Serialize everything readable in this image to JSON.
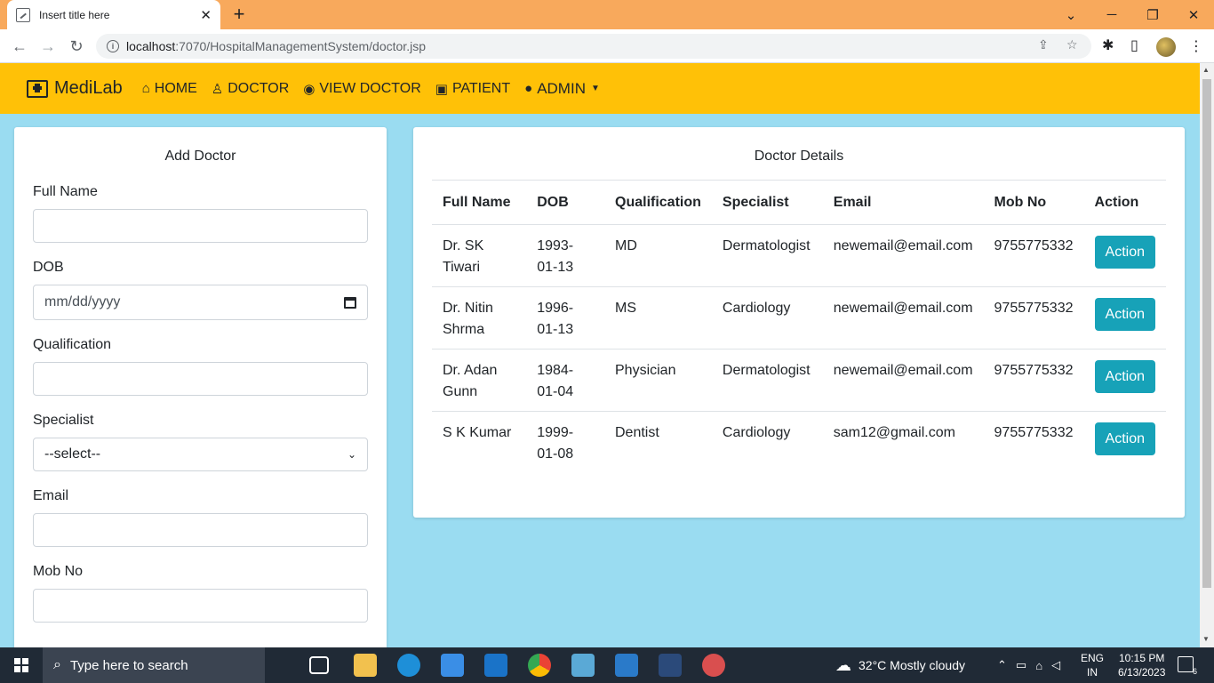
{
  "browser": {
    "tab_title": "Insert title here",
    "url_host": "localhost",
    "url_path": ":7070/HospitalManagementSystem/doctor.jsp"
  },
  "navbar": {
    "brand": "MediLab",
    "items": [
      {
        "label": "HOME",
        "icon": "home-icon"
      },
      {
        "label": "DOCTOR",
        "icon": "user-doctor-icon"
      },
      {
        "label": "VIEW DOCTOR",
        "icon": "eye-icon"
      },
      {
        "label": "PATIENT",
        "icon": "notes-medical-icon"
      },
      {
        "label": "ADMIN",
        "icon": "user-icon"
      }
    ]
  },
  "add_doctor": {
    "title": "Add Doctor",
    "full_name_label": "Full Name",
    "dob_label": "DOB",
    "dob_placeholder": "mm/dd/yyyy",
    "qualification_label": "Qualification",
    "specialist_label": "Specialist",
    "specialist_value": "--select--",
    "email_label": "Email",
    "mob_label": "Mob No"
  },
  "doctor_details": {
    "title": "Doctor Details",
    "columns": [
      "Full Name",
      "DOB",
      "Qualification",
      "Specialist",
      "Email",
      "Mob No",
      "Action"
    ],
    "rows": [
      {
        "name": "Dr. SK Tiwari",
        "dob": "1993-01-13",
        "qualification": "MD",
        "specialist": "Dermatologist",
        "email": "newemail@email.com",
        "mob": "9755775332",
        "action": "Action"
      },
      {
        "name": "Dr. Nitin Shrma",
        "dob": "1996-01-13",
        "qualification": "MS",
        "specialist": "Cardiology",
        "email": "newemail@email.com",
        "mob": "9755775332",
        "action": "Action"
      },
      {
        "name": "Dr. Adan Gunn",
        "dob": "1984-01-04",
        "qualification": "Physician",
        "specialist": "Dermatologist",
        "email": "newemail@email.com",
        "mob": "9755775332",
        "action": "Action"
      },
      {
        "name": "S K Kumar",
        "dob": "1999-01-08",
        "qualification": "Dentist",
        "specialist": "Cardiology",
        "email": "sam12@gmail.com",
        "mob": "9755775332",
        "action": "Action"
      }
    ]
  },
  "taskbar": {
    "search_placeholder": "Type here to search",
    "weather": "32°C  Mostly cloudy",
    "lang_line1": "ENG",
    "lang_line2": "IN",
    "time": "10:15 PM",
    "date": "6/13/2023",
    "notif_count": "6"
  },
  "colors": {
    "navbar": "#ffc107",
    "page_bg": "#9adcf1",
    "action_button": "#17a2b8",
    "tabbar": "#f8a95c"
  }
}
